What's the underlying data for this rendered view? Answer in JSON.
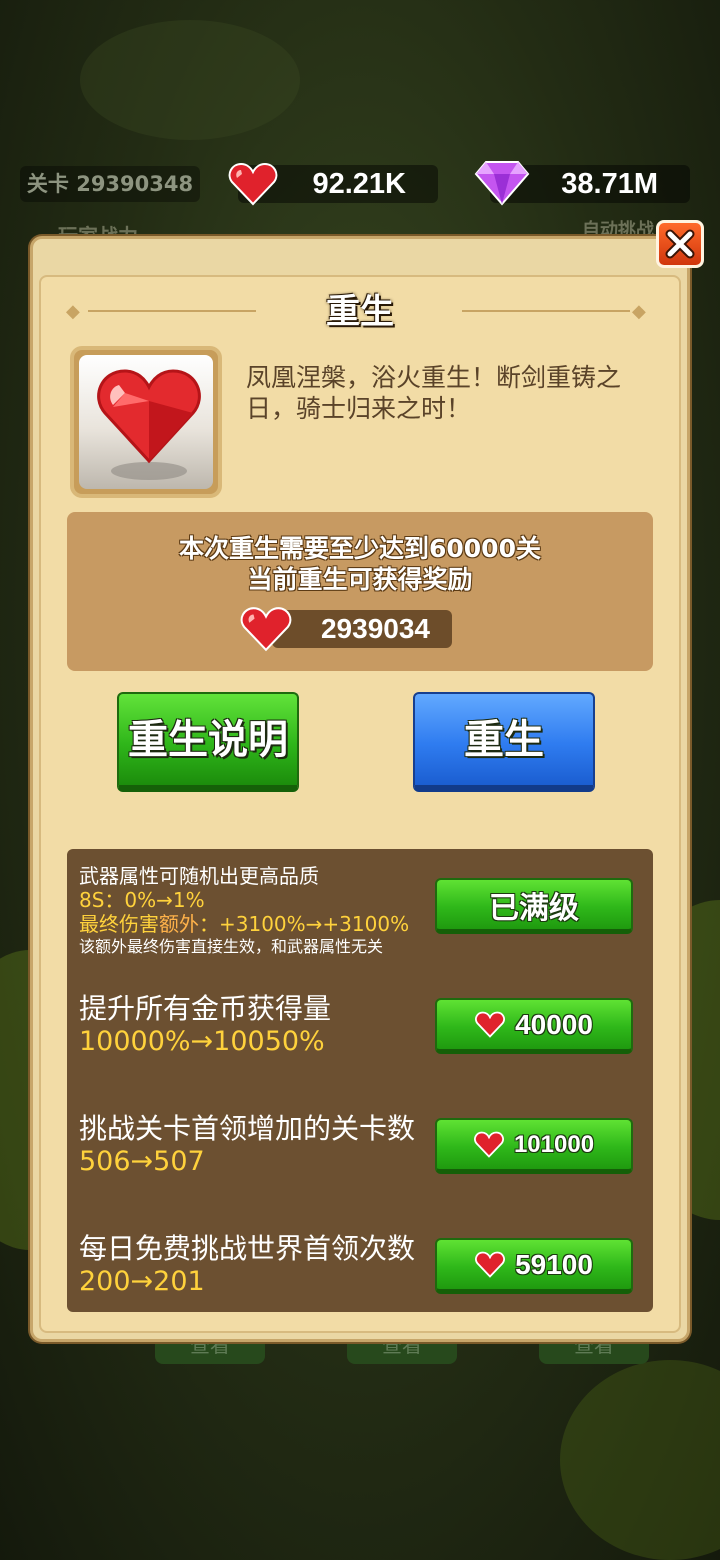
{
  "hud": {
    "level_text": "关卡 29390348",
    "hearts": "92.21K",
    "gems": "38.71M",
    "dim_left": "玩家战力",
    "dim_right": "自动挑战",
    "view_buttons": [
      "查看",
      "查看",
      "查看"
    ]
  },
  "modal": {
    "title": "重生",
    "description": "凤凰涅槃，浴火重生！断剑重铸之日，骑士归来之时！",
    "requirement_line1": "本次重生需要至少达到60000关",
    "requirement_line2": "当前重生可获得奖励",
    "reward_amount": "2939034",
    "btn_info": "重生说明",
    "btn_rebirth": "重生"
  },
  "upgrades": [
    {
      "line1": "武器属性可随机出更高品质",
      "line2": "8S：0%→1%",
      "line3_a": "最终伤害",
      "line3_b": "额外",
      "line3_c": "：+3100%→+3100%",
      "line4": "该额外最终伤害直接生效，和武器属性无关",
      "button": "已满级"
    },
    {
      "title": "提升所有金币获得量",
      "value": "10000%→10050%",
      "cost": "40000"
    },
    {
      "title": "挑战关卡首领增加的关卡数",
      "value": "506→507",
      "cost": "101000"
    },
    {
      "title": "每日免费挑战世界首领次数",
      "value": "200→201",
      "cost": "59100"
    }
  ],
  "colors": {
    "accent_yellow": "#ffd23c",
    "orange_text": "#ffb24a",
    "green_button": "#2fb61a",
    "blue_button": "#2f7cf0",
    "panel": "#f2dca6"
  },
  "icons": [
    "heart-gem-icon",
    "diamond-icon",
    "close-icon"
  ]
}
